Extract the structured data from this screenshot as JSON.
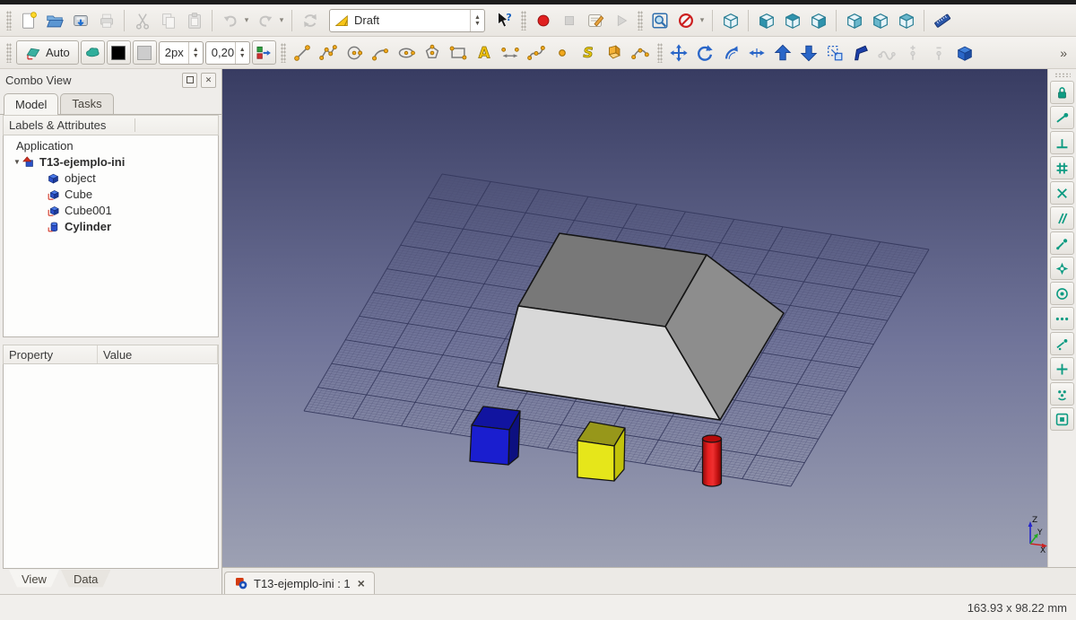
{
  "workbench": {
    "selected": "Draft"
  },
  "toolbar_top": {
    "items": [
      {
        "type": "handle"
      },
      {
        "type": "button",
        "name": "new-document",
        "icon": "new"
      },
      {
        "type": "button",
        "name": "open-document",
        "icon": "open"
      },
      {
        "type": "button",
        "name": "save-document",
        "icon": "save"
      },
      {
        "type": "button",
        "name": "print-document",
        "icon": "print",
        "enabled": false
      },
      {
        "type": "sep"
      },
      {
        "type": "button",
        "name": "cut",
        "icon": "cut",
        "enabled": false
      },
      {
        "type": "button",
        "name": "copy",
        "icon": "copy",
        "enabled": false
      },
      {
        "type": "button",
        "name": "paste",
        "icon": "paste",
        "enabled": false
      },
      {
        "type": "sep"
      },
      {
        "type": "button",
        "name": "undo",
        "icon": "undo",
        "enabled": false,
        "dropdown": true
      },
      {
        "type": "button",
        "name": "redo",
        "icon": "redo",
        "enabled": false,
        "dropdown": true
      },
      {
        "type": "sep"
      },
      {
        "type": "button",
        "name": "refresh",
        "icon": "refresh",
        "enabled": false
      },
      {
        "type": "workbench"
      },
      {
        "type": "button",
        "name": "whats-this",
        "icon": "whatsthis"
      },
      {
        "type": "handle"
      },
      {
        "type": "button",
        "name": "macro-record",
        "icon": "record"
      },
      {
        "type": "button",
        "name": "macro-stop",
        "icon": "stop",
        "enabled": false
      },
      {
        "type": "button",
        "name": "macro-edit",
        "icon": "macroedit"
      },
      {
        "type": "button",
        "name": "macro-play",
        "icon": "play",
        "enabled": false
      },
      {
        "type": "handle"
      },
      {
        "type": "button",
        "name": "view-fit-all",
        "icon": "fitall"
      },
      {
        "type": "button",
        "name": "draw-style",
        "icon": "drawstyle",
        "dropdown": true
      },
      {
        "type": "sep"
      },
      {
        "type": "button",
        "name": "view-axonometric",
        "icon": "cube",
        "cube": "axo"
      },
      {
        "type": "sep"
      },
      {
        "type": "button",
        "name": "view-front",
        "icon": "cube",
        "cube": "front"
      },
      {
        "type": "button",
        "name": "view-top",
        "icon": "cube",
        "cube": "top"
      },
      {
        "type": "button",
        "name": "view-right",
        "icon": "cube",
        "cube": "right"
      },
      {
        "type": "sep"
      },
      {
        "type": "button",
        "name": "view-rear",
        "icon": "cube",
        "cube": "rear"
      },
      {
        "type": "button",
        "name": "view-bottom",
        "icon": "cube",
        "cube": "bottom"
      },
      {
        "type": "button",
        "name": "view-left",
        "icon": "cube",
        "cube": "left"
      },
      {
        "type": "sep"
      },
      {
        "type": "button",
        "name": "measure-distance",
        "icon": "ruler"
      }
    ]
  },
  "toolbar_draft": {
    "items": [
      {
        "type": "handle"
      },
      {
        "type": "auto",
        "name": "working-plane-selector",
        "label": "Auto"
      },
      {
        "type": "smbtn",
        "name": "construction-mode-toggle",
        "icon": "construction"
      },
      {
        "type": "smbtn",
        "name": "line-color-swatch",
        "icon": "swblack"
      },
      {
        "type": "smbtn",
        "name": "face-color-swatch",
        "icon": "swgray"
      },
      {
        "type": "spin",
        "name": "line-width-field",
        "value": "2px"
      },
      {
        "type": "spin",
        "name": "text-scale-field",
        "value": "0,20"
      },
      {
        "type": "smbtn",
        "name": "apply-style-button",
        "icon": "applystyle"
      },
      {
        "type": "handle"
      },
      {
        "type": "button",
        "name": "draft-line",
        "icon": "line"
      },
      {
        "type": "button",
        "name": "draft-wire",
        "icon": "wire"
      },
      {
        "type": "button",
        "name": "draft-circle",
        "icon": "circle"
      },
      {
        "type": "button",
        "name": "draft-arc",
        "icon": "arc"
      },
      {
        "type": "button",
        "name": "draft-ellipse",
        "icon": "ellipse"
      },
      {
        "type": "button",
        "name": "draft-polygon",
        "icon": "polygon"
      },
      {
        "type": "button",
        "name": "draft-rectangle",
        "icon": "rect"
      },
      {
        "type": "button",
        "name": "draft-text",
        "icon": "text"
      },
      {
        "type": "button",
        "name": "draft-dimension",
        "icon": "dim"
      },
      {
        "type": "button",
        "name": "draft-bspline",
        "icon": "bspline"
      },
      {
        "type": "button",
        "name": "draft-point",
        "icon": "point"
      },
      {
        "type": "button",
        "name": "draft-shapestring",
        "icon": "sstring"
      },
      {
        "type": "button",
        "name": "draft-facebinder",
        "icon": "facebinder"
      },
      {
        "type": "button",
        "name": "draft-bezier",
        "icon": "bezier"
      },
      {
        "type": "handle"
      },
      {
        "type": "button",
        "name": "draft-move",
        "icon": "move"
      },
      {
        "type": "button",
        "name": "draft-rotate",
        "icon": "rotate"
      },
      {
        "type": "button",
        "name": "draft-offset",
        "icon": "offset"
      },
      {
        "type": "button",
        "name": "draft-trimex",
        "icon": "trimex"
      },
      {
        "type": "button",
        "name": "draft-upgrade",
        "icon": "up"
      },
      {
        "type": "button",
        "name": "draft-downgrade",
        "icon": "down"
      },
      {
        "type": "button",
        "name": "draft-scale",
        "icon": "scale"
      },
      {
        "type": "button",
        "name": "draft-edit",
        "icon": "editflag"
      },
      {
        "type": "button",
        "name": "draft-wire-to-bspline",
        "icon": "gwire",
        "enabled": false
      },
      {
        "type": "button",
        "name": "draft-add-point",
        "icon": "gaddpoint",
        "enabled": false
      },
      {
        "type": "button",
        "name": "draft-delete-point",
        "icon": "gdelpoint",
        "enabled": false
      },
      {
        "type": "button",
        "name": "draft-to-sketch",
        "icon": "cubeblue"
      },
      {
        "type": "chevron",
        "glyph": "»"
      }
    ]
  },
  "combo_view": {
    "title": "Combo View",
    "tabs": [
      {
        "label": "Model",
        "active": true
      },
      {
        "label": "Tasks",
        "active": false
      }
    ],
    "tree_header": "Labels & Attributes",
    "application_label": "Application",
    "document": {
      "label": "T13-ejemplo-ini",
      "icon": "treedoc",
      "bold": true,
      "expanded": true
    },
    "items": [
      {
        "label": "object",
        "icon": "treecube",
        "bold": false
      },
      {
        "label": "Cube",
        "icon": "treepartcube",
        "bold": false
      },
      {
        "label": "Cube001",
        "icon": "treepartcube",
        "bold": false
      },
      {
        "label": "Cylinder",
        "icon": "treecyl",
        "bold": true
      }
    ],
    "property_columns": [
      "Property",
      "Value"
    ],
    "bottom_tabs": [
      {
        "label": "View",
        "active": true
      },
      {
        "label": "Data",
        "active": false
      }
    ]
  },
  "snap_toolbar": {
    "items": [
      {
        "name": "snap-lock",
        "icon": "snaplock"
      },
      {
        "name": "snap-endpoint",
        "icon": "snapend"
      },
      {
        "name": "snap-midpoint",
        "icon": "snapmid"
      },
      {
        "name": "snap-grid",
        "icon": "snapgrid"
      },
      {
        "name": "snap-intersection",
        "icon": "snapint"
      },
      {
        "name": "snap-parallel",
        "icon": "snappar"
      },
      {
        "name": "snap-perpendicular",
        "icon": "snapperp"
      },
      {
        "name": "snap-angle",
        "icon": "snapang"
      },
      {
        "name": "snap-center",
        "icon": "snapcenter"
      },
      {
        "name": "snap-extension",
        "icon": "snapext"
      },
      {
        "name": "snap-near",
        "icon": "snapnear"
      },
      {
        "name": "snap-ortho",
        "icon": "snaportho"
      },
      {
        "name": "snap-special",
        "icon": "snapspecial"
      },
      {
        "name": "snap-working-plane",
        "icon": "snapwp"
      }
    ]
  },
  "mdi": {
    "tab_label": "T13-ejemplo-ini : 1",
    "close_glyph": "×"
  },
  "statusbar": {
    "dimensions": "163.93 x 98.22 mm"
  },
  "scene": {
    "axis_labels": {
      "x": "X",
      "y": "Y",
      "z": "Z"
    },
    "colors": {
      "bg_top": "#383c62",
      "bg_mid": "#71759a",
      "bg_bottom": "#9da1b3",
      "grid_minor": "#4b4e74",
      "grid_major": "#34375c",
      "prism_top": "#787878",
      "prism_front": "#d8d8d8",
      "prism_right": "#8d8d8d",
      "cube_blue_top": "#1114a0",
      "cube_blue_front": "#1a1ecf",
      "cube_blue_right": "#0d1080",
      "cube_yellow_top": "#97971a",
      "cube_yellow_front": "#e6e61a",
      "cube_yellow_right": "#c2c20a",
      "cylinder_body": "#dd1414",
      "cylinder_top": "#b40a0a",
      "edge": "#141414"
    }
  }
}
